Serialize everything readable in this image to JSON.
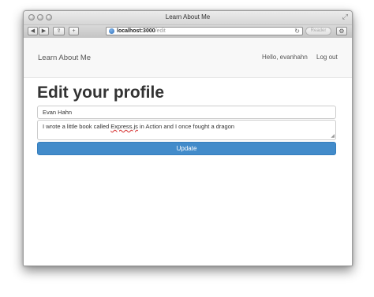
{
  "window": {
    "title": "Learn About Me"
  },
  "browser": {
    "url_host": "localhost:3000",
    "url_path": "/edit",
    "reader_label": "Reader",
    "back_glyph": "◀",
    "forward_glyph": "▶",
    "share_glyph": "⇪",
    "add_glyph": "+",
    "reload_glyph": "↻",
    "gear_glyph": "⚙",
    "fullscreen_glyph": "⤢"
  },
  "navbar": {
    "brand": "Learn About Me",
    "greeting": "Hello, evanhahn",
    "logout": "Log out"
  },
  "form": {
    "heading": "Edit your profile",
    "name_value": "Evan Hahn",
    "bio_before": "I wrote a little book called ",
    "bio_misspelled": "Express.js",
    "bio_after": " in Action and I once fought a dragon",
    "submit_label": "Update"
  },
  "colors": {
    "primary_button": "#428bca",
    "navbar_bg": "#f8f8f8",
    "spellcheck_underline": "#d42a2a"
  },
  "icons": {
    "back": "back-arrow-icon",
    "forward": "forward-arrow-icon",
    "share": "share-icon",
    "add": "add-tab-icon",
    "globe": "globe-icon",
    "reload": "reload-icon",
    "gear": "gear-icon",
    "fullscreen": "fullscreen-icon"
  }
}
